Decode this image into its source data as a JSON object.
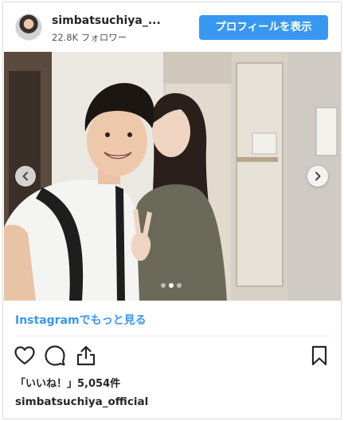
{
  "header": {
    "username": "simbatsuchiya_...",
    "followers": "22.8K フォロワー",
    "profile_button": "プロフィールを表示"
  },
  "photo": {
    "carousel_count": 3,
    "active_index": 1
  },
  "links": {
    "more_on_instagram": "Instagramでもっと見る"
  },
  "engagement": {
    "likes_text": "「いいね！」5,054件"
  },
  "caption": {
    "account": "simbatsuchiya_official"
  },
  "colors": {
    "accent": "#3897f0",
    "text": "#262626"
  }
}
